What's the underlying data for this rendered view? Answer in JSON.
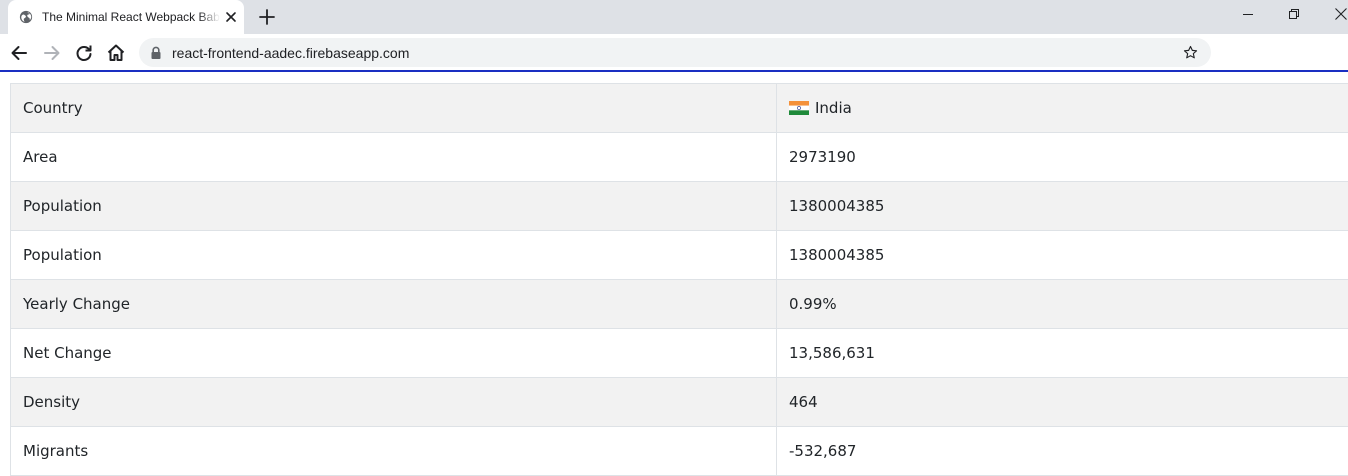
{
  "browser": {
    "tab": {
      "title": "The Minimal React Webpack Babel Setup"
    },
    "address_bar": {
      "url": "react-frontend-aadec.firebaseapp.com"
    }
  },
  "colors": {
    "accent_progress": "#1a2fc2",
    "row_stripe": "#f2f2f2",
    "border": "#dee2e6"
  },
  "icons": {
    "tab_favicon": "globe-icon",
    "flag": "india-flag-icon"
  },
  "table": {
    "rows": [
      {
        "label": "Country",
        "value": "India"
      },
      {
        "label": "Area",
        "value": "2973190"
      },
      {
        "label": "Population",
        "value": "1380004385"
      },
      {
        "label": "Population",
        "value": "1380004385"
      },
      {
        "label": "Yearly Change",
        "value": "0.99%"
      },
      {
        "label": "Net Change",
        "value": "13,586,631"
      },
      {
        "label": "Density",
        "value": "464"
      },
      {
        "label": "Migrants",
        "value": "-532,687"
      }
    ]
  }
}
